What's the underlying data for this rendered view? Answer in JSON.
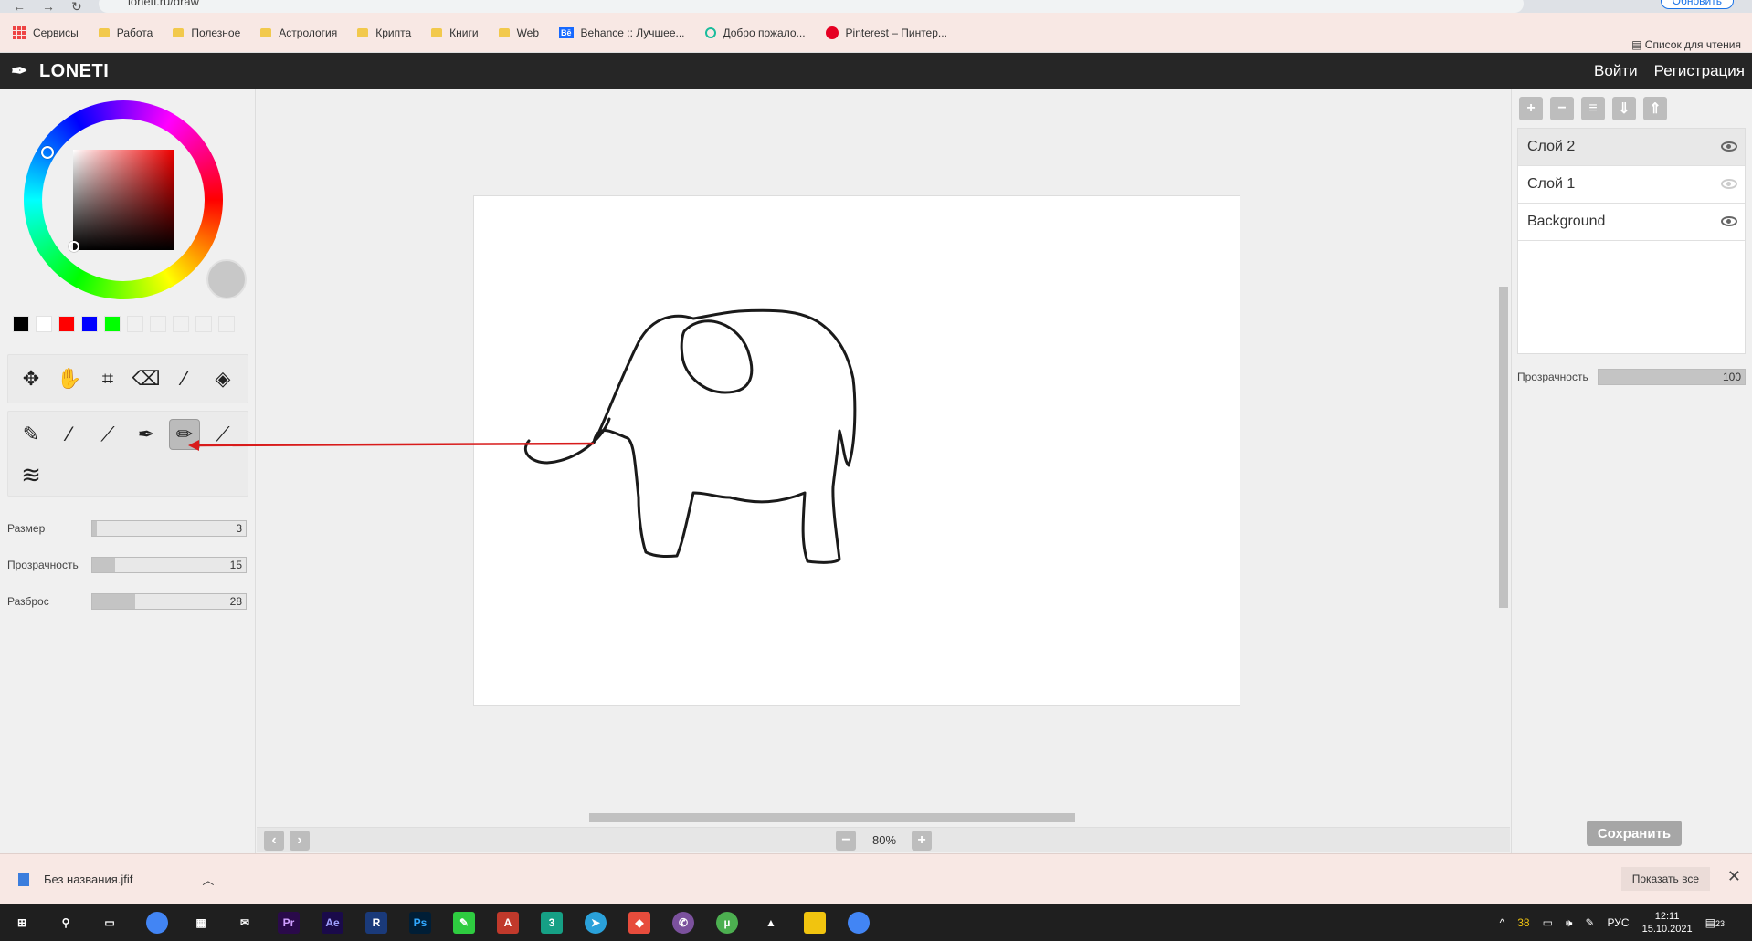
{
  "browser": {
    "url": "loneti.ru/draw",
    "update_label": "Обновить",
    "reading_list": "Список для чтения",
    "bookmarks": [
      "Сервисы",
      "Работа",
      "Полезное",
      "Астрология",
      "Крипта",
      "Книги",
      "Web",
      "Behance :: Лучшее...",
      "Добро пожало...",
      "Pinterest – Пинтер..."
    ]
  },
  "app": {
    "logo": "LONETI",
    "login": "Войти",
    "register": "Регистрация"
  },
  "colors": {
    "current": "#c8c8c8",
    "swatches": [
      "#000000",
      "#ffffff",
      "#ff0000",
      "#0000ff",
      "#00ff00",
      "#f0f0f0",
      "#f0f0f0",
      "#f0f0f0",
      "#f0f0f0",
      "#f0f0f0"
    ]
  },
  "tools": {
    "row1": [
      "move-icon",
      "hand-icon",
      "crop-icon",
      "eraser-icon",
      "eyedropper-icon",
      "fill-icon"
    ],
    "brushes": [
      "pencil-icon",
      "brush-icon",
      "round-brush-icon",
      "pen-icon",
      "marker-icon",
      "fine-brush-icon",
      "wave-brush-icon"
    ],
    "active_brush": "marker-icon"
  },
  "sliders": {
    "size": {
      "label": "Размер",
      "value": "3",
      "fraction": 0.03
    },
    "opacity": {
      "label": "Прозрачность",
      "value": "15",
      "fraction": 0.15
    },
    "scatter": {
      "label": "Разброс",
      "value": "28",
      "fraction": 0.28
    }
  },
  "zoom": {
    "value": "80%"
  },
  "layers": {
    "items": [
      {
        "name": "Слой 2",
        "visible": true,
        "selected": true
      },
      {
        "name": "Слой 1",
        "visible": false,
        "selected": false
      },
      {
        "name": "Background",
        "visible": true,
        "selected": false
      }
    ],
    "opacity_label": "Прозрачность",
    "opacity_value": "100"
  },
  "save_label": "Сохранить",
  "download": {
    "file": "Без названия.jfif",
    "show_all": "Показать все"
  },
  "taskbar": {
    "lang": "РУС",
    "time": "12:11",
    "date": "15.10.2021",
    "notifications": "23",
    "temp": "38"
  }
}
